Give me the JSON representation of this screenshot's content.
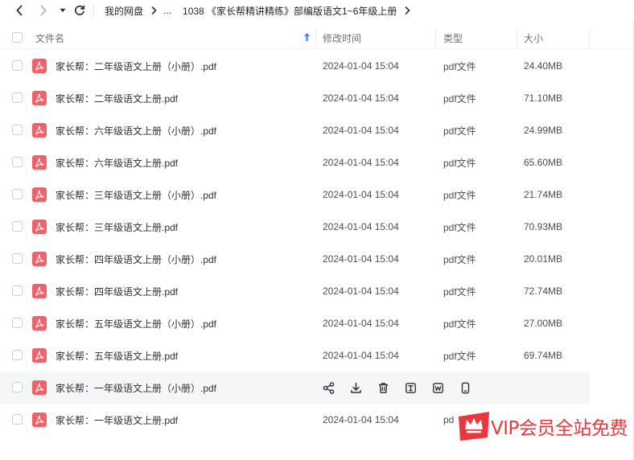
{
  "nav": {
    "breadcrumb": [
      "我的网盘",
      "...",
      "1038 《家长帮精讲精练》部编版语文1~6年级上册"
    ]
  },
  "columns": {
    "name": "文件名",
    "modified": "修改时间",
    "type": "类型",
    "size": "大小"
  },
  "files": [
    {
      "name": "家长帮：二年级语文上册（小册）.pdf",
      "modified": "2024-01-04 15:04",
      "type": "pdf文件",
      "size": "24.40MB"
    },
    {
      "name": "家长帮：二年级语文上册.pdf",
      "modified": "2024-01-04 15:04",
      "type": "pdf文件",
      "size": "71.10MB"
    },
    {
      "name": "家长帮：六年级语文上册（小册）.pdf",
      "modified": "2024-01-04 15:04",
      "type": "pdf文件",
      "size": "24.99MB"
    },
    {
      "name": "家长帮：六年级语文上册.pdf",
      "modified": "2024-01-04 15:04",
      "type": "pdf文件",
      "size": "65.60MB"
    },
    {
      "name": "家长帮：三年级语文上册（小册）.pdf",
      "modified": "2024-01-04 15:04",
      "type": "pdf文件",
      "size": "21.74MB"
    },
    {
      "name": "家长帮：三年级语文上册.pdf",
      "modified": "2024-01-04 15:04",
      "type": "pdf文件",
      "size": "70.93MB"
    },
    {
      "name": "家长帮：四年级语文上册（小册）.pdf",
      "modified": "2024-01-04 15:04",
      "type": "pdf文件",
      "size": "20.01MB"
    },
    {
      "name": "家长帮：四年级语文上册.pdf",
      "modified": "2024-01-04 15:04",
      "type": "pdf文件",
      "size": "72.74MB"
    },
    {
      "name": "家长帮：五年级语文上册（小册）.pdf",
      "modified": "2024-01-04 15:04",
      "type": "pdf文件",
      "size": "27.00MB"
    },
    {
      "name": "家长帮：五年级语文上册.pdf",
      "modified": "2024-01-04 15:04",
      "type": "pdf文件",
      "size": "69.74MB"
    },
    {
      "name": "家长帮：一年级语文上册（小册）.pdf"
    },
    {
      "name": "家长帮：一年级语文上册.pdf",
      "modified": "2024-01-04 15:04",
      "type": "pd"
    }
  ],
  "hover_actions": [
    "share-icon",
    "download-icon",
    "delete-icon",
    "text-icon",
    "word-icon",
    "phone-icon"
  ],
  "watermark": {
    "text": "VIP会员全站免费"
  },
  "colors": {
    "pdf_icon": "#f0626a",
    "sort_arrow": "#3b82f6",
    "watermark": "#e8383d",
    "hover_row": "#f5f6f8"
  }
}
